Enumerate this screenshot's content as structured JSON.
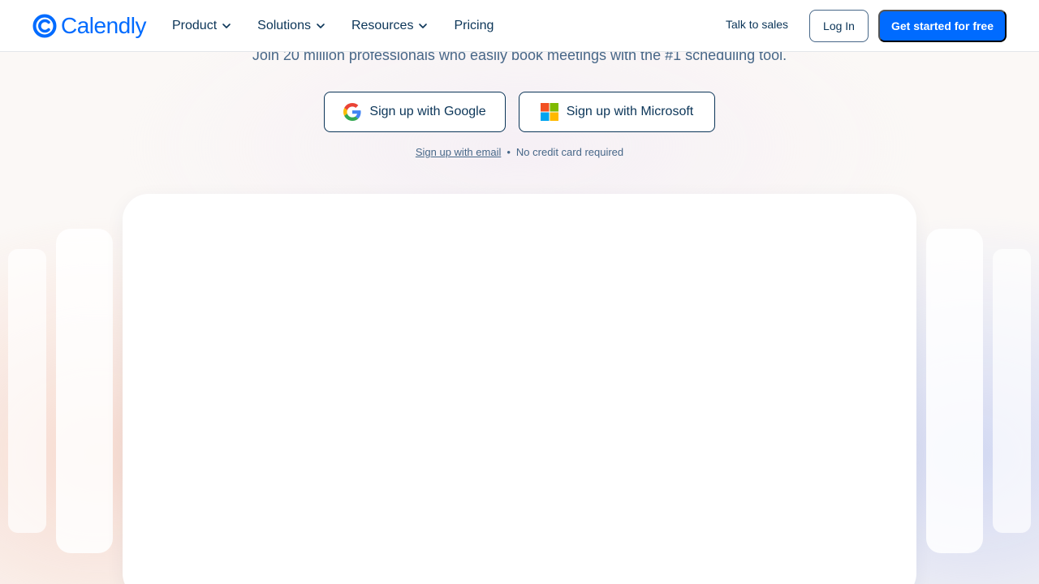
{
  "nav": {
    "brand": "Calendly",
    "menu": [
      {
        "label": "Product",
        "has_dropdown": true
      },
      {
        "label": "Solutions",
        "has_dropdown": true
      },
      {
        "label": "Resources",
        "has_dropdown": true
      },
      {
        "label": "Pricing",
        "has_dropdown": false
      }
    ],
    "talk_to_sales": "Talk to sales",
    "login": "Log In",
    "cta": "Get started for free"
  },
  "hero": {
    "subtitle": "Join 20 million professionals who easily book meetings with the #1 scheduling tool.",
    "google_button": "Sign up with Google",
    "microsoft_button": "Sign up with Microsoft",
    "email_link": "Sign up with email",
    "separator": "•",
    "no_card": "No credit card required"
  },
  "colors": {
    "brand_blue": "#006bff",
    "text_dark": "#0b3558",
    "text_muted": "#476788"
  },
  "icons": [
    "calendly-logo-icon",
    "chevron-down-icon",
    "google-icon",
    "microsoft-icon"
  ]
}
